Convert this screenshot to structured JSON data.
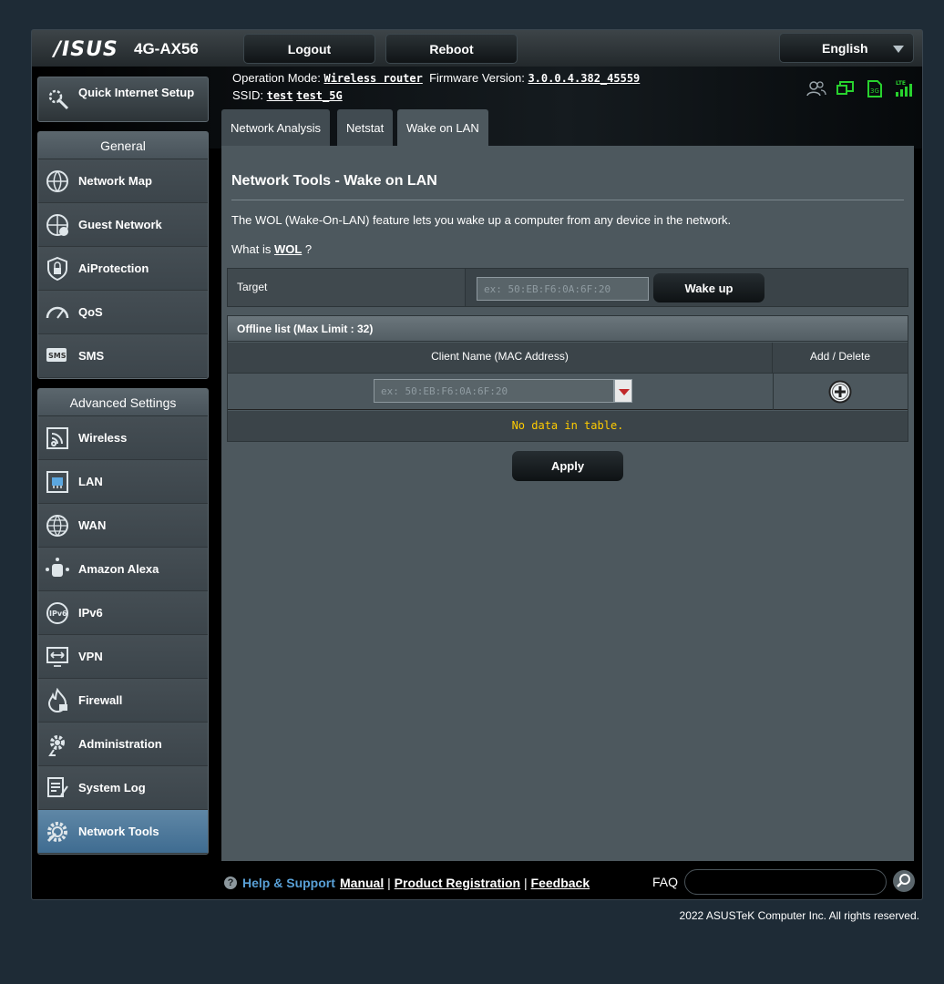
{
  "header": {
    "logo": "/ISUS",
    "model": "4G-AX56",
    "logout": "Logout",
    "reboot": "Reboot",
    "language": "English",
    "operation_mode_label": "Operation Mode:",
    "operation_mode": "Wireless router",
    "firmware_label": "Firmware Version:",
    "firmware": "3.0.0.4.382_45559",
    "ssid_label": "SSID:",
    "ssid_1": "test",
    "ssid_2": "test_5G",
    "status_icons": [
      "clients-icon",
      "usb-icon",
      "sim-icon",
      "lte-signal-icon"
    ]
  },
  "sidebar": {
    "qis": "Quick Internet Setup",
    "general_title": "General",
    "general": [
      {
        "label": "Network Map",
        "icon": "network-map-icon"
      },
      {
        "label": "Guest Network",
        "icon": "guest-network-icon"
      },
      {
        "label": "AiProtection",
        "icon": "shield-lock-icon"
      },
      {
        "label": "QoS",
        "icon": "gauge-icon"
      },
      {
        "label": "SMS",
        "icon": "sms-icon"
      }
    ],
    "advanced_title": "Advanced Settings",
    "advanced": [
      {
        "label": "Wireless",
        "icon": "wireless-icon"
      },
      {
        "label": "LAN",
        "icon": "lan-icon"
      },
      {
        "label": "WAN",
        "icon": "globe-icon"
      },
      {
        "label": "Amazon Alexa",
        "icon": "alexa-icon"
      },
      {
        "label": "IPv6",
        "icon": "ipv6-icon"
      },
      {
        "label": "VPN",
        "icon": "vpn-icon"
      },
      {
        "label": "Firewall",
        "icon": "firewall-icon"
      },
      {
        "label": "Administration",
        "icon": "gear-icon"
      },
      {
        "label": "System Log",
        "icon": "log-icon"
      },
      {
        "label": "Network Tools",
        "icon": "network-tools-icon"
      }
    ],
    "active": "Network Tools"
  },
  "tabs": [
    "Network Analysis",
    "Netstat",
    "Wake on LAN"
  ],
  "content": {
    "title": "Network Tools - Wake on LAN",
    "description": "The WOL (Wake-On-LAN) feature lets you wake up a computer from any device in the network.",
    "what_is": "What is",
    "wol_link": "WOL",
    "question": " ?",
    "target_label": "Target",
    "target_placeholder": "ex: 50:EB:F6:0A:6F:20",
    "wake_button": "Wake up",
    "offline_caption": "Offline list (Max Limit : 32)",
    "col_client": "Client Name (MAC Address)",
    "col_add_delete": "Add / Delete",
    "client_placeholder": "ex: 50:EB:F6:0A:6F:20",
    "no_data": "No data in table.",
    "apply": "Apply"
  },
  "footer": {
    "help": "Help & Support",
    "manual": "Manual",
    "sep": "|",
    "product_registration": "Product Registration",
    "feedback": "Feedback",
    "faq": "FAQ",
    "copyright": "2022 ASUSTeK Computer Inc. All rights reserved."
  },
  "colors": {
    "accent_active": "#4f7ea3",
    "no_data_text": "#ffcc00",
    "link_blue": "#59a0d6"
  }
}
